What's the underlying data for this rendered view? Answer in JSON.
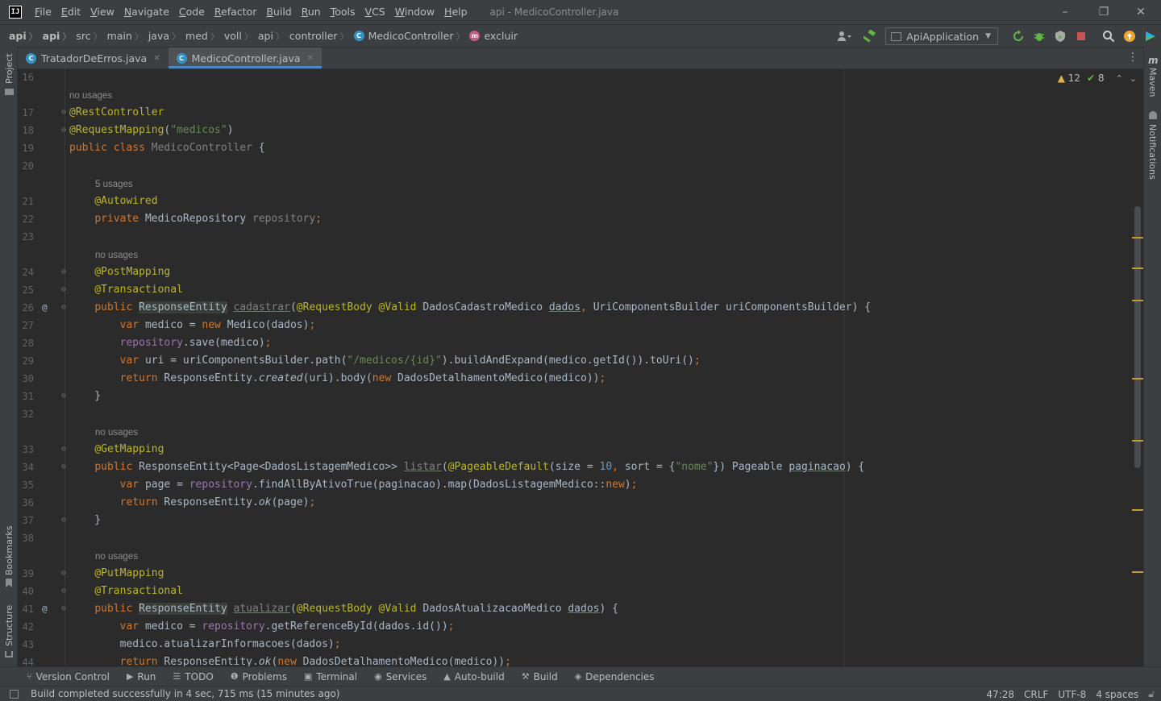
{
  "menu": {
    "items": [
      "File",
      "Edit",
      "View",
      "Navigate",
      "Code",
      "Refactor",
      "Build",
      "Run",
      "Tools",
      "VCS",
      "Window",
      "Help"
    ],
    "title": "api - MedicoController.java",
    "logo_text": "IJ"
  },
  "window_controls": {
    "minimize": "–",
    "restore": "❐",
    "close": "✕"
  },
  "breadcrumbs": {
    "items": [
      "api",
      "api",
      "src",
      "main",
      "java",
      "med",
      "voll",
      "api",
      "controller"
    ],
    "class_name": "MedicoController",
    "method_name": "excluir",
    "class_icon": "c-class-icon",
    "method_icon": "m-method-icon"
  },
  "toolbar": {
    "run_config": "ApiApplication",
    "icons": [
      "user-icon",
      "hammer-icon",
      "rerun-icon",
      "debug-icon",
      "coverage-icon",
      "stop-icon",
      "search-icon",
      "update-icon",
      "toolbox-icon"
    ]
  },
  "tabs": [
    {
      "label": "TratadorDeErros.java",
      "active": false
    },
    {
      "label": "MedicoController.java",
      "active": true
    }
  ],
  "left_stripe": {
    "project": "Project",
    "bookmarks": "Bookmarks",
    "structure": "Structure"
  },
  "right_stripe": {
    "maven": "Maven",
    "notifications": "Notifications"
  },
  "inspection": {
    "warnings": "12",
    "checks": "8"
  },
  "code": {
    "lines": [
      {
        "n": "16"
      },
      {
        "hint": "no usages",
        "indent": 0
      },
      {
        "n": "17",
        "html": "<span class=\"an\">@RestController</span>"
      },
      {
        "n": "18",
        "html": "<span class=\"an\">@RequestMapping</span>(<span class=\"st\">\"medicos\"</span>)"
      },
      {
        "n": "19",
        "html": "<span class=\"kw\">public class </span><span class=\"gr\">MedicoController</span> {"
      },
      {
        "n": "20"
      },
      {
        "hint": "5 usages",
        "indent": 1
      },
      {
        "n": "21",
        "html": "    <span class=\"an\">@Autowired</span>"
      },
      {
        "n": "22",
        "html": "    <span class=\"kw\">private </span>MedicoRepository <span class=\"gr\">repository</span><span class=\"kw\">;</span>"
      },
      {
        "n": "23"
      },
      {
        "hint": "no usages",
        "indent": 1
      },
      {
        "n": "24",
        "html": "    <span class=\"an\">@PostMapping</span>"
      },
      {
        "n": "25",
        "html": "    <span class=\"an\">@Transactional</span>"
      },
      {
        "n": "26",
        "html": "    <span class=\"kw\">public </span><span class=\"hl\">ResponseEntity</span> <span class=\"gr ul\">cadastrar</span>(<span class=\"an\">@RequestBody</span> <span class=\"an\">@Valid</span> DadosCadastroMedico <span class=\"ul\">dados</span><span class=\"kw\">, </span>UriComponentsBuilder uriComponentsBuilder) {"
      },
      {
        "n": "27",
        "html": "        <span class=\"kw\">var </span>medico = <span class=\"kw\">new </span>Medico(dados)<span class=\"kw\">;</span>"
      },
      {
        "n": "28",
        "html": "        <span class=\"fd\">repository</span>.save(medico)<span class=\"kw\">;</span>"
      },
      {
        "n": "29",
        "html": "        <span class=\"kw\">var </span>uri = uriComponentsBuilder.path(<span class=\"st\">\"/medicos/{id}\"</span>).buildAndExpand(medico.getId()).toUri()<span class=\"kw\">;</span>"
      },
      {
        "n": "30",
        "html": "        <span class=\"kw\">return </span>ResponseEntity.<span class=\"it\">created</span>(uri).body(<span class=\"kw\">new </span>DadosDetalhamentoMedico(medico))<span class=\"kw\">;</span>"
      },
      {
        "n": "31",
        "html": "    }"
      },
      {
        "n": "32"
      },
      {
        "hint": "no usages",
        "indent": 1
      },
      {
        "n": "33",
        "html": "    <span class=\"an\">@GetMapping</span>"
      },
      {
        "n": "34",
        "html": "    <span class=\"kw\">public </span>ResponseEntity&lt;Page&lt;DadosListagemMedico&gt;&gt; <span class=\"gr ul\">listar</span>(<span class=\"an\">@PageableDefault</span>(size = <span class=\"nm\">10</span><span class=\"kw\">, </span>sort = {<span class=\"st\">\"nome\"</span>}) Pageable <span class=\"ul\">paginacao</span>) {"
      },
      {
        "n": "35",
        "html": "        <span class=\"kw\">var </span>page = <span class=\"fd\">repository</span>.findAllByAtivoTrue(paginacao).map(DadosListagemMedico::<span class=\"kw\">new</span>)<span class=\"kw\">;</span>"
      },
      {
        "n": "36",
        "html": "        <span class=\"kw\">return </span>ResponseEntity.<span class=\"it\">ok</span>(page)<span class=\"kw\">;</span>"
      },
      {
        "n": "37",
        "html": "    }"
      },
      {
        "n": "38"
      },
      {
        "hint": "no usages",
        "indent": 1
      },
      {
        "n": "39",
        "html": "    <span class=\"an\">@PutMapping</span>"
      },
      {
        "n": "40",
        "html": "    <span class=\"an\">@Transactional</span>"
      },
      {
        "n": "41",
        "html": "    <span class=\"kw\">public </span><span class=\"hl\">ResponseEntity</span> <span class=\"gr ul\">atualizar</span>(<span class=\"an\">@RequestBody</span> <span class=\"an\">@Valid</span> DadosAtualizacaoMedico <span class=\"ul\">dados</span>) {"
      },
      {
        "n": "42",
        "html": "        <span class=\"kw\">var </span>medico = <span class=\"fd\">repository</span>.getReferenceById(dados.id())<span class=\"kw\">;</span>"
      },
      {
        "n": "43",
        "html": "        medico.atualizarInformacoes(dados)<span class=\"kw\">;</span>"
      },
      {
        "n": "44",
        "html": "        <span class=\"kw\">return </span>ResponseEntity.<span class=\"it\">ok</span>(<span class=\"kw\">new </span>DadosDetalhamentoMedico(medico))<span class=\"kw\">;</span>"
      }
    ]
  },
  "bottom_tools": [
    {
      "label": "Version Control",
      "icon": "branch-icon"
    },
    {
      "label": "Run",
      "icon": "run-icon"
    },
    {
      "label": "TODO",
      "icon": "list-icon"
    },
    {
      "label": "Problems",
      "icon": "problems-icon"
    },
    {
      "label": "Terminal",
      "icon": "terminal-icon"
    },
    {
      "label": "Services",
      "icon": "services-icon"
    },
    {
      "label": "Auto-build",
      "icon": "autobuild-icon"
    },
    {
      "label": "Build",
      "icon": "hammer-icon"
    },
    {
      "label": "Dependencies",
      "icon": "dependencies-icon"
    }
  ],
  "status": {
    "message": "Build completed successfully in 4 sec, 715 ms (15 minutes ago)",
    "position": "47:28",
    "line_sep": "CRLF",
    "encoding": "UTF-8",
    "indent": "4 spaces"
  },
  "colors": {
    "keyword": "#cc7832",
    "annotation": "#bbb529",
    "string": "#6a8759",
    "number": "#6897bb",
    "field": "#9876aa",
    "accent": "#4a88c7"
  }
}
